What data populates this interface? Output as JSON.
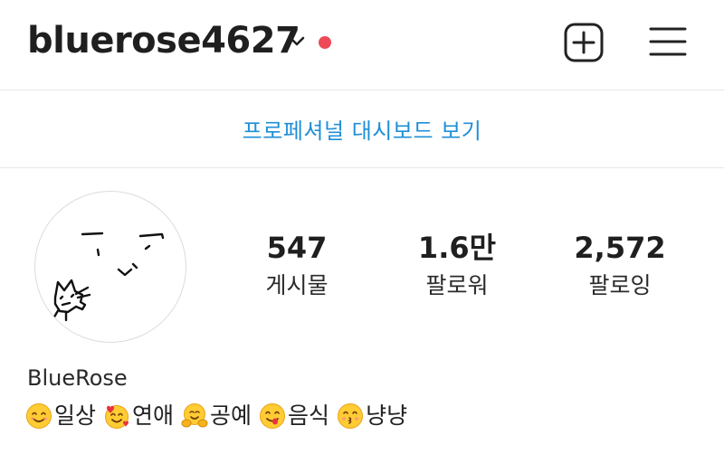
{
  "header": {
    "username": "bluerose4627",
    "notification_dot_color": "#ed4956",
    "add_icon": "add-post-icon",
    "menu_icon": "hamburger-menu-icon"
  },
  "dashboard": {
    "label": "프로페셔널 대시보드 보기",
    "color": "#1f8fd6"
  },
  "profile": {
    "avatar": "hand-drawn-face-with-cat-doodle",
    "stats": [
      {
        "value": "547",
        "label": "게시물"
      },
      {
        "value": "1.6만",
        "label": "팔로워"
      },
      {
        "value": "2,572",
        "label": "팔로잉"
      }
    ],
    "display_name": "BlueRose",
    "bio": [
      {
        "emoji": "smiling-face-icon",
        "text": "일상"
      },
      {
        "emoji": "smiling-face-with-hearts-icon",
        "text": "연애"
      },
      {
        "emoji": "hugging-face-icon",
        "text": "공예"
      },
      {
        "emoji": "yum-face-icon",
        "text": "음식"
      },
      {
        "emoji": "kissing-face-icon",
        "text": "냥냥"
      }
    ]
  }
}
